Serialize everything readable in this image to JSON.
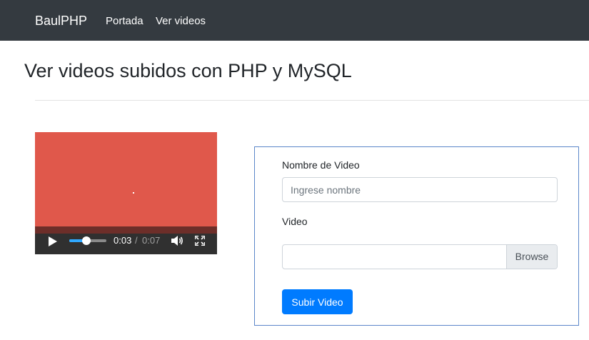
{
  "navbar": {
    "brand": "BaulPHP",
    "links": [
      "Portada",
      "Ver videos"
    ]
  },
  "page": {
    "title": "Ver videos subidos con PHP y MySQL"
  },
  "video_player": {
    "current_time": "0:03",
    "separator": "/",
    "duration": "0:07",
    "volume_level": 0.45,
    "icons": [
      "play-icon",
      "speaker-icon",
      "fullscreen-icon"
    ]
  },
  "form": {
    "nombre_label": "Nombre de Video",
    "nombre_placeholder": "Ingrese nombre",
    "nombre_value": "",
    "video_label": "Video",
    "file_value": "",
    "browse_label": "Browse",
    "submit_label": "Subir Video"
  },
  "colors": {
    "navbar_bg": "#343a40",
    "video_bg": "#e0584b",
    "primary": "#007bff",
    "card_border": "#5b86c9"
  }
}
